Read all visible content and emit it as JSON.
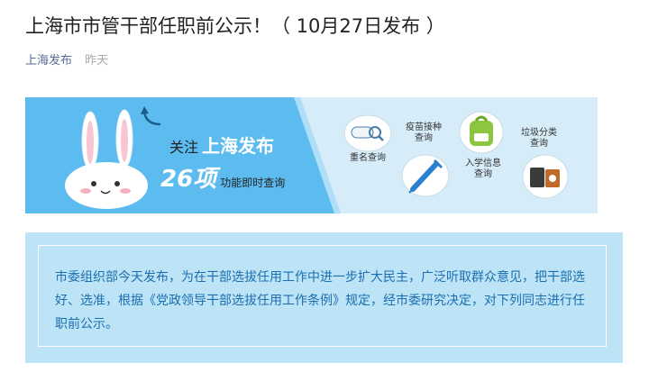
{
  "article": {
    "title": "上海市市管干部任职前公示！（ 10月27日发布 ）",
    "account": "上海发布",
    "time": "昨天"
  },
  "banner": {
    "follow_prefix": "关注",
    "follow_brand": "上海发布",
    "count": "26项",
    "count_label": "功能即时查询",
    "features": [
      {
        "icon": "search-name-icon",
        "label": "重名查询"
      },
      {
        "icon": "syringe-icon",
        "label": "疫苗接种\n查询"
      },
      {
        "icon": "backpack-icon",
        "label": "入学信息\n查询"
      },
      {
        "icon": "trash-bin-icon",
        "label": "垃圾分类\n查询"
      }
    ],
    "colors": {
      "blue": "#5cbcf0",
      "light": "#d6edf9"
    }
  },
  "notice": {
    "text": "市委组织部今天发布，为在干部选拔任用工作中进一步扩大民主，广泛听取群众意见，把干部选好、选准，根据《党政领导干部选拔任用工作条例》规定，经市委研究决定，对下列同志进行任职前公示。"
  }
}
